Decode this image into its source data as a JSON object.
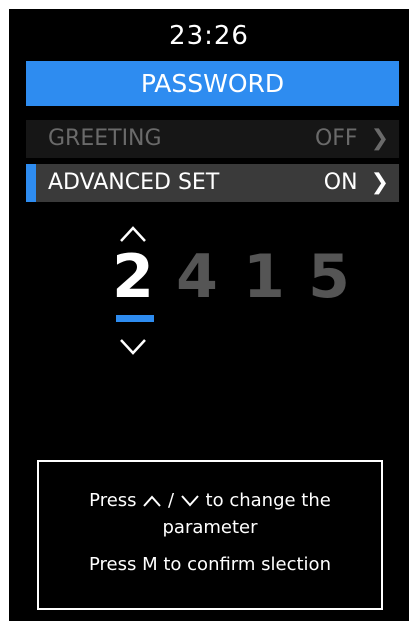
{
  "status": {
    "time": "23:26"
  },
  "header": {
    "title": "PASSWORD"
  },
  "menu": {
    "items": [
      {
        "label": "GREETING",
        "value": "OFF"
      },
      {
        "label": "ADVANCED SET",
        "value": "ON"
      }
    ]
  },
  "password": {
    "digits": [
      "2",
      "4",
      "1",
      "5"
    ],
    "selected_index": 0
  },
  "help": {
    "line1_prefix": "Press",
    "line1_sep": "/",
    "line1_suffix": "to change the",
    "line2": "parameter",
    "line3": "Press M to confirm slection"
  },
  "colors": {
    "accent": "#2e8cf0",
    "background": "#000000",
    "active_row": "#3a3a3a",
    "inactive_digit": "#555555"
  }
}
